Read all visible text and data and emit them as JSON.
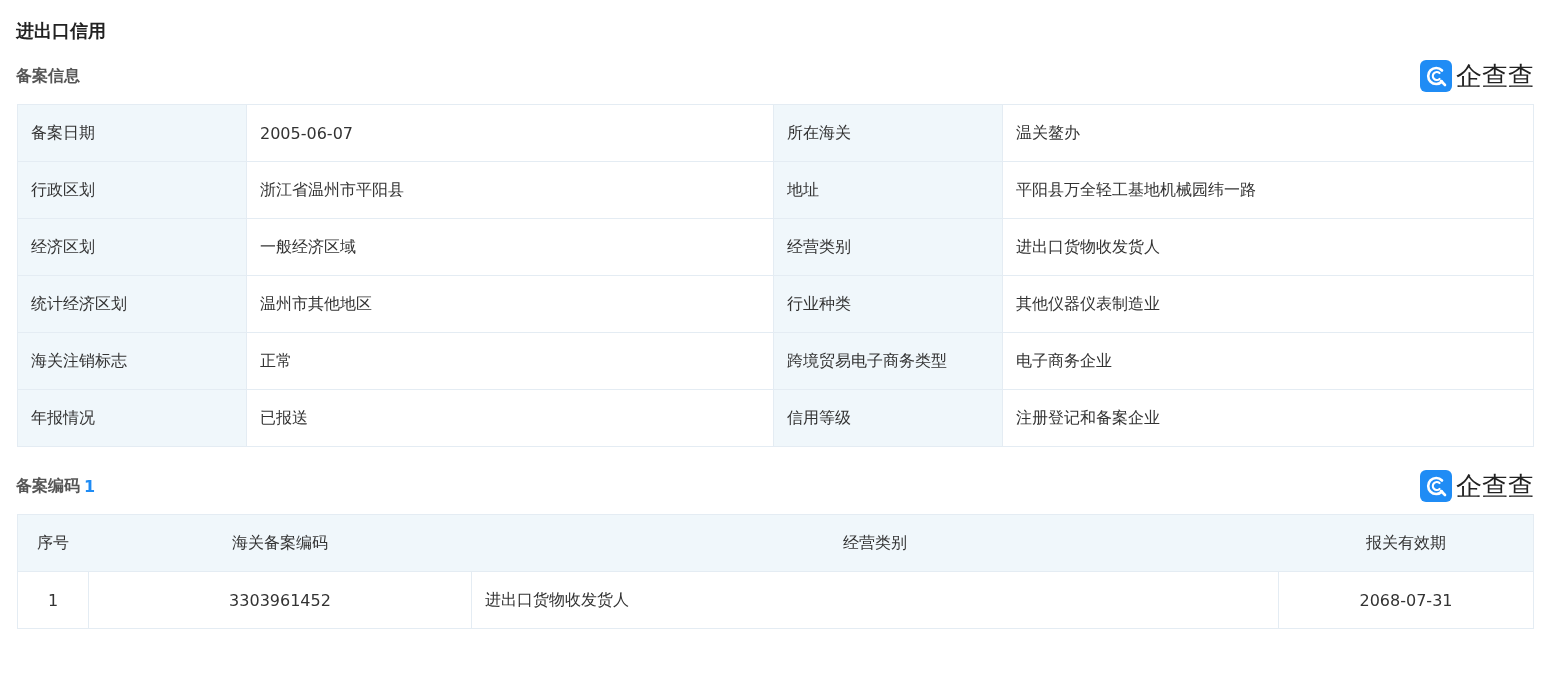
{
  "title": "进出口信用",
  "filing_info": {
    "title": "备案信息",
    "logo": {
      "text": "企查查"
    },
    "rows": [
      [
        {
          "label": "备案日期",
          "value": "2005-06-07"
        },
        {
          "label": "所在海关",
          "value": "温关鳌办"
        }
      ],
      [
        {
          "label": "行政区划",
          "value": "浙江省温州市平阳县"
        },
        {
          "label": "地址",
          "value": "平阳县万全轻工基地机械园纬一路"
        }
      ],
      [
        {
          "label": "经济区划",
          "value": "一般经济区域"
        },
        {
          "label": "经营类别",
          "value": "进出口货物收发货人"
        }
      ],
      [
        {
          "label": "统计经济区划",
          "value": "温州市其他地区"
        },
        {
          "label": "行业种类",
          "value": "其他仪器仪表制造业"
        }
      ],
      [
        {
          "label": "海关注销标志",
          "value": "正常"
        },
        {
          "label": "跨境贸易电子商务类型",
          "value": "电子商务企业"
        }
      ],
      [
        {
          "label": "年报情况",
          "value": "已报送"
        },
        {
          "label": "信用等级",
          "value": "注册登记和备案企业"
        }
      ]
    ]
  },
  "filing_codes": {
    "title": "备案编码",
    "count": "1",
    "logo": {
      "text": "企查查"
    },
    "columns": [
      "序号",
      "海关备案编码",
      "经营类别",
      "报关有效期"
    ],
    "rows": [
      [
        "1",
        "3303961452",
        "进出口货物收发货人",
        "2068-07-31"
      ]
    ]
  }
}
